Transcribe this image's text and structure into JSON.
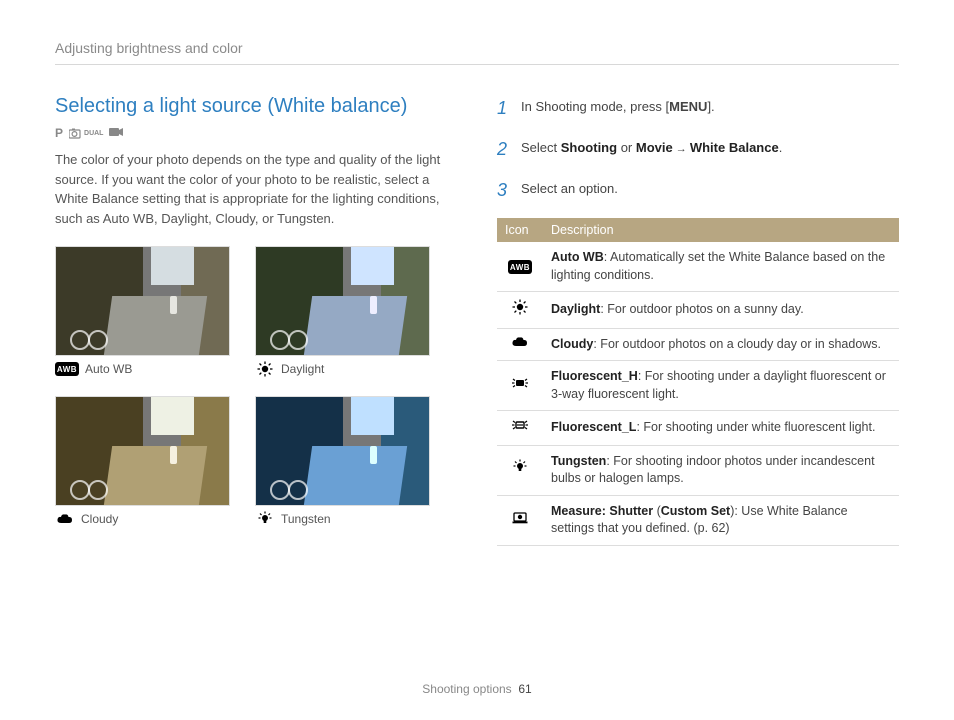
{
  "header": {
    "title": "Adjusting brightness and color"
  },
  "section": {
    "title": "Selecting a light source (White balance)",
    "mode_p": "P",
    "mode_dual": "DUAL",
    "body": "The color of your photo depends on the type and quality of the light source. If you want the color of your photo to be realistic, select a White Balance setting that is appropriate for the lighting conditions, such as Auto WB, Daylight, Cloudy, or Tungsten."
  },
  "thumbs": [
    {
      "label": "Auto WB",
      "icon": "awb"
    },
    {
      "label": "Daylight",
      "icon": "sun"
    },
    {
      "label": "Cloudy",
      "icon": "cloud"
    },
    {
      "label": "Tungsten",
      "icon": "bulb"
    }
  ],
  "thumb_tints": {
    "auto": {
      "sky": "#d5dde1",
      "bl": "#3c3a28",
      "br": "#706a54",
      "road": "#9a9a92",
      "person": "#e6e6e0"
    },
    "daylight": {
      "sky": "#cfe4ff",
      "bl": "#2e3a24",
      "br": "#5e6a4e",
      "road": "#95a9c4",
      "person": "#eef"
    },
    "cloudy": {
      "sky": "#eef1e4",
      "bl": "#4a4022",
      "br": "#8a7a4a",
      "road": "#b0a074",
      "person": "#f5f0e0"
    },
    "tungsten": {
      "sky": "#bfe0ff",
      "bl": "#143048",
      "br": "#2a5a7a",
      "road": "#6aa0d4",
      "person": "#dff"
    }
  },
  "steps": {
    "s1_a": "In Shooting mode, press [",
    "s1_menu": "MENU",
    "s1_b": "].",
    "s2_a": "Select ",
    "s2_b": "Shooting",
    "s2_c": " or ",
    "s2_d": "Movie",
    "s2_e": " → ",
    "s2_f": "White Balance",
    "s2_g": ".",
    "s3": "Select an option."
  },
  "table": {
    "h_icon": "Icon",
    "h_desc": "Description",
    "rows": [
      {
        "icon": "awb",
        "name": "Auto WB",
        "desc": ": Automatically set the White Balance based on the lighting conditions."
      },
      {
        "icon": "sun",
        "name": "Daylight",
        "desc": ": For outdoor photos on a sunny day."
      },
      {
        "icon": "cloud",
        "name": "Cloudy",
        "desc": ": For outdoor photos on a cloudy day or in shadows."
      },
      {
        "icon": "flh",
        "name": "Fluorescent_H",
        "desc": ": For shooting under a daylight fluorescent or 3-way fluorescent light."
      },
      {
        "icon": "fll",
        "name": "Fluorescent_L",
        "desc": ": For shooting under white fluorescent light."
      },
      {
        "icon": "bulb",
        "name": "Tungsten",
        "desc": ": For shooting indoor photos under incandescent bulbs or halogen lamps."
      },
      {
        "icon": "custom",
        "name": "Measure: Shutter",
        "paren": " (",
        "name2": "Custom Set",
        "desc": "): Use White Balance settings that you defined. (p. 62)"
      }
    ]
  },
  "footer": {
    "section": "Shooting options",
    "page": "61"
  }
}
